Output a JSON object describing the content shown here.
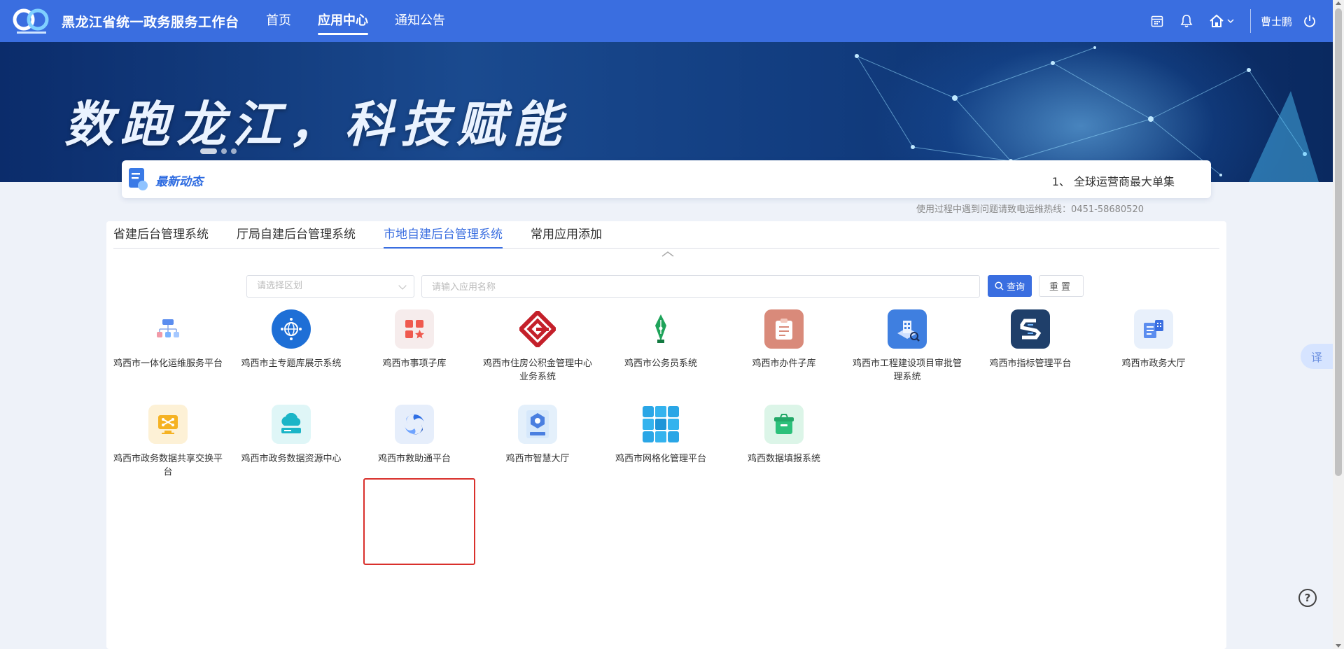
{
  "header": {
    "title": "黑龙江省统一政务服务工作台",
    "nav": [
      {
        "label": "首页",
        "active": false
      },
      {
        "label": "应用中心",
        "active": true
      },
      {
        "label": "通知公告",
        "active": false
      }
    ],
    "user": "曹士鹏",
    "icons": [
      "calendar-icon",
      "bell-icon",
      "home-icon",
      "chevron-down-icon",
      "power-icon"
    ]
  },
  "banner": {
    "slogan": "数跑龙江，科技赋能",
    "slides": 3,
    "active_slide": 0
  },
  "news": {
    "label": "最新动态",
    "text": "1、 全球运营商最大单集"
  },
  "hotline": "使用过程中遇到问题请致电运维热线：0451-58680520",
  "tabs": [
    {
      "label": "省建后台管理系统",
      "active": false
    },
    {
      "label": "厅局自建后台管理系统",
      "active": false
    },
    {
      "label": "市地自建后台管理系统",
      "active": true
    },
    {
      "label": "常用应用添加",
      "active": false
    }
  ],
  "filter": {
    "region_placeholder": "请选择区划",
    "name_placeholder": "请输入应用名称",
    "search_label": "查询",
    "reset_label": "重置"
  },
  "apps": [
    {
      "name": "鸡西市一体化运维服务平台",
      "icon": "ops-network-icon",
      "color": "#ffffff"
    },
    {
      "name": "鸡西市主专题库展示系统",
      "icon": "globe-network-icon",
      "color": "#1e6fd6"
    },
    {
      "name": "鸡西市事项子库",
      "icon": "grid-star-icon",
      "color": "#f6ecec"
    },
    {
      "name": "鸡西市住房公积金管理中心业务系统",
      "icon": "housing-fund-logo-icon",
      "color": "#ffffff"
    },
    {
      "name": "鸡西市公务员系统",
      "icon": "pen-nib-icon",
      "color": "#ffffff"
    },
    {
      "name": "鸡西市办件子库",
      "icon": "clipboard-icon",
      "color": "#d98a7a"
    },
    {
      "name": "鸡西市工程建设项目审批管理系统",
      "icon": "building-approval-icon",
      "color": "#3f7fe0"
    },
    {
      "name": "鸡西市指标管理平台",
      "icon": "s-logo-icon",
      "color": "#1f3f6a"
    },
    {
      "name": "鸡西市政务大厅",
      "icon": "document-building-icon",
      "color": "#e8f0fb"
    },
    {
      "name": "鸡西市政务数据共享交换平台",
      "icon": "data-exchange-icon",
      "color": "#fdf1d6"
    },
    {
      "name": "鸡西市政务数据资源中心",
      "icon": "cloud-server-icon",
      "color": "#dff6f7"
    },
    {
      "name": "鸡西市救助通平台",
      "icon": "swirl-logo-icon",
      "color": "#e6eefb"
    },
    {
      "name": "鸡西市智慧大厅",
      "icon": "smart-hall-icon",
      "color": "#e4f0fb"
    },
    {
      "name": "鸡西市网格化管理平台",
      "icon": "grid-tiles-icon",
      "color": "#ffffff"
    },
    {
      "name": "鸡西数据填报系统",
      "icon": "data-box-icon",
      "color": "#dcf5e8"
    }
  ],
  "translate_label": "译",
  "help_label": "?"
}
